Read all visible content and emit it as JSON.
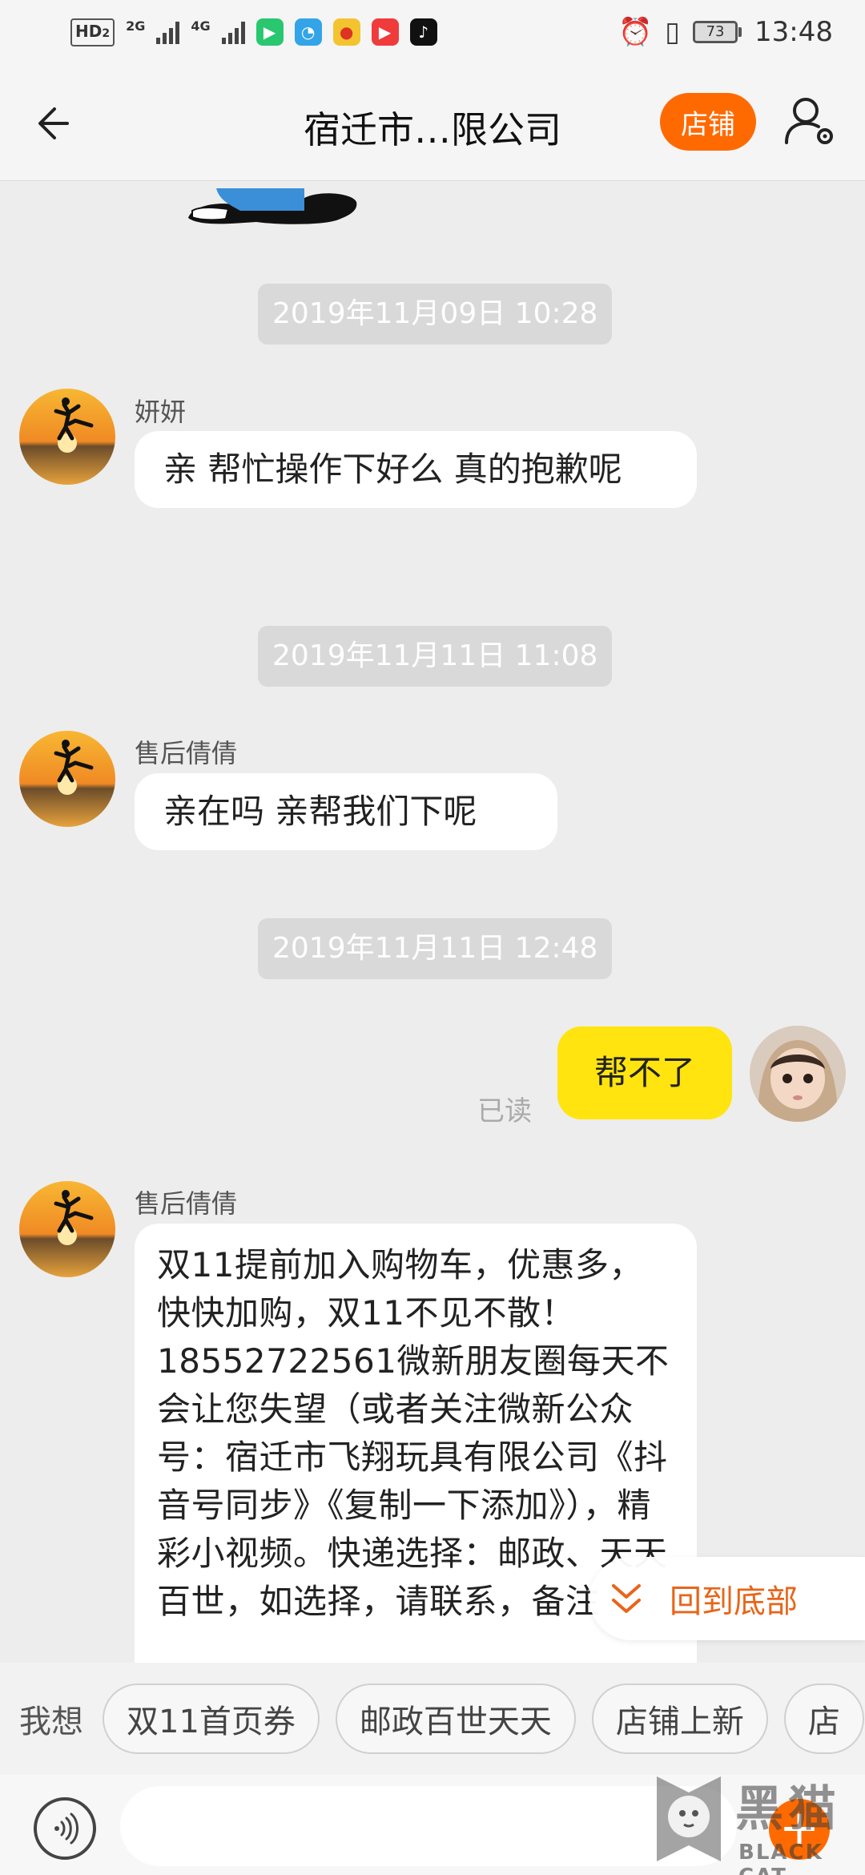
{
  "status_bar": {
    "hd_label": "HD",
    "hd_sub": "2",
    "net1": "2G",
    "net2": "4G",
    "battery": "73",
    "time": "13:48"
  },
  "header": {
    "title": "宿迁市…限公司",
    "store_label": "店铺"
  },
  "messages": [
    {
      "type": "timestamp",
      "text": "2019年11月09日 10:28"
    },
    {
      "type": "incoming",
      "sender": "妍妍",
      "text": "亲 帮忙操作下好么  真的抱歉呢"
    },
    {
      "type": "timestamp",
      "text": "2019年11月11日 11:08"
    },
    {
      "type": "incoming",
      "sender": "售后倩倩",
      "text": "亲在吗  亲帮我们下呢"
    },
    {
      "type": "timestamp",
      "text": "2019年11月11日 12:48"
    },
    {
      "type": "outgoing",
      "text": "帮不了",
      "status": "已读"
    },
    {
      "type": "incoming",
      "sender": "售后倩倩",
      "text": "双11提前加入购物车，优惠多，快快加购，双11不见不散！18552722561微新朋友圈每天不会让您失望（或者关注微新公众号：宿迁市飞翔玩具有限公司《抖音号同步》《复制一下添加》），精彩小视频。快递选择：邮政、天天百世，如选择，请联系，备注"
    }
  ],
  "back_to_bottom": "回到底部",
  "quick_replies": {
    "prefix": "我想",
    "chips": [
      "双11首页券",
      "邮政百世天天",
      "店铺上新",
      "店"
    ]
  },
  "input": {
    "placeholder": ""
  },
  "watermark": {
    "text": "黑猫",
    "sub": "BLACK CAT"
  },
  "colors": {
    "accent": "#ff6a00",
    "my_bubble": "#ffe40f",
    "link": "#e8651a"
  }
}
